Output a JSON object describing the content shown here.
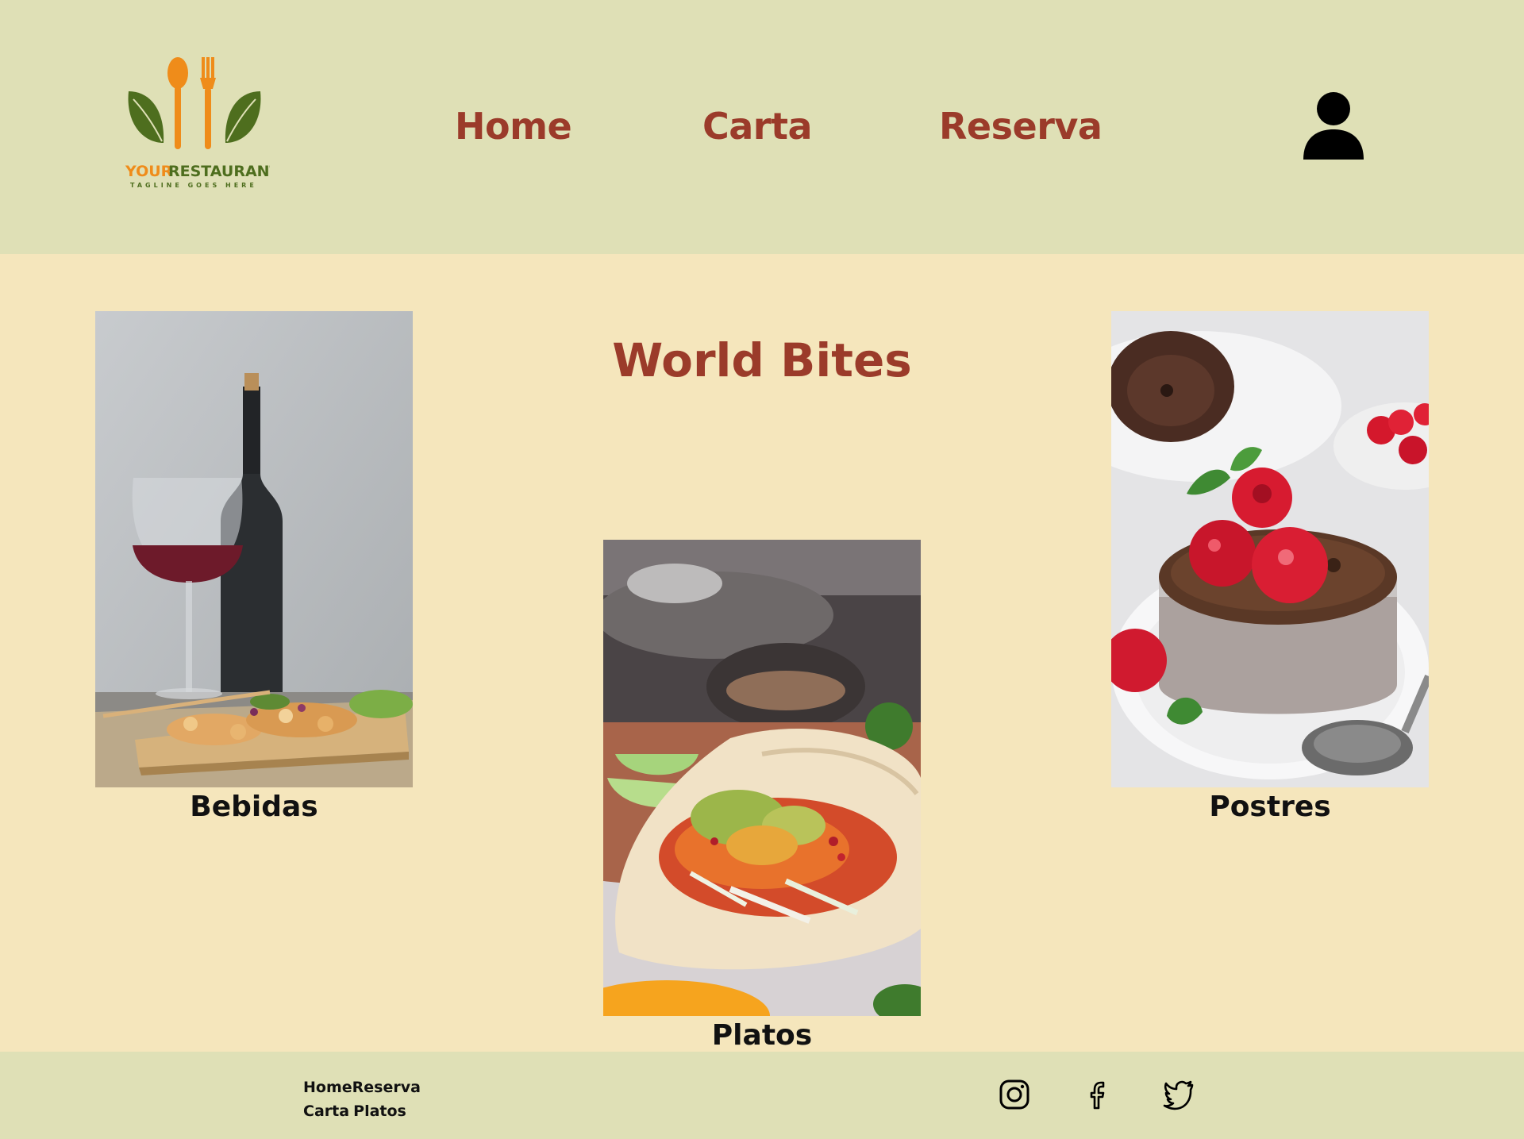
{
  "header": {
    "logo": {
      "brand_part1": "YOUR",
      "brand_part2": "RESTAURANT",
      "tagline": "TAGLINE GOES HERE"
    },
    "nav": [
      {
        "label": "Home"
      },
      {
        "label": "Carta"
      },
      {
        "label": "Reserva"
      }
    ],
    "user_icon": "user-icon"
  },
  "main": {
    "title": "World Bites",
    "cards": [
      {
        "label": "Bebidas",
        "image": "wine-and-food-photo"
      },
      {
        "label": "Platos",
        "image": "taco-photo"
      },
      {
        "label": "Postres",
        "image": "chocolate-cake-raspberries-photo"
      }
    ]
  },
  "footer": {
    "links_row1": [
      "Home",
      "Reserva"
    ],
    "links_row2": [
      "Carta",
      "Platos"
    ],
    "social": [
      "instagram-icon",
      "facebook-icon",
      "twitter-icon"
    ]
  },
  "colors": {
    "header_bg": "#dfe0b6",
    "page_bg": "#f5e6bc",
    "accent": "#9b3b2a",
    "logo_orange": "#ef8c1a",
    "logo_green": "#4e6e1e"
  }
}
